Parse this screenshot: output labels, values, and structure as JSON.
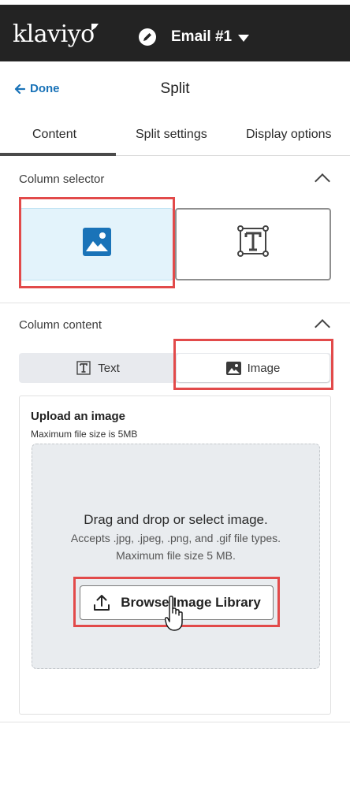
{
  "app": {
    "logo_text": "klaviyo",
    "email_title": "Email #1"
  },
  "header": {
    "done_label": "Done",
    "title": "Split"
  },
  "tabs": [
    {
      "label": "Content",
      "active": true
    },
    {
      "label": "Split settings",
      "active": false
    },
    {
      "label": "Display options",
      "active": false
    }
  ],
  "column_selector": {
    "title": "Column selector",
    "options": [
      {
        "icon": "image-icon",
        "selected": true
      },
      {
        "icon": "text-icon",
        "selected": false
      }
    ]
  },
  "column_content": {
    "title": "Column content",
    "segments": [
      {
        "label": "Text",
        "icon": "text-icon",
        "active": false
      },
      {
        "label": "Image",
        "icon": "image-icon",
        "active": true
      }
    ]
  },
  "upload": {
    "title": "Upload an image",
    "subtitle": "Maximum file size is 5MB",
    "drop_title": "Drag and drop or select image.",
    "drop_line1": "Accepts .jpg, .jpeg, .png, and .gif file types.",
    "drop_line2": "Maximum file size 5 MB.",
    "browse_label": "Browse Image Library"
  },
  "colors": {
    "topbar": "#232323",
    "accent_blue": "#1a73b8",
    "selected_bg": "#e3f3fb",
    "highlight_red": "#e24a4a"
  }
}
